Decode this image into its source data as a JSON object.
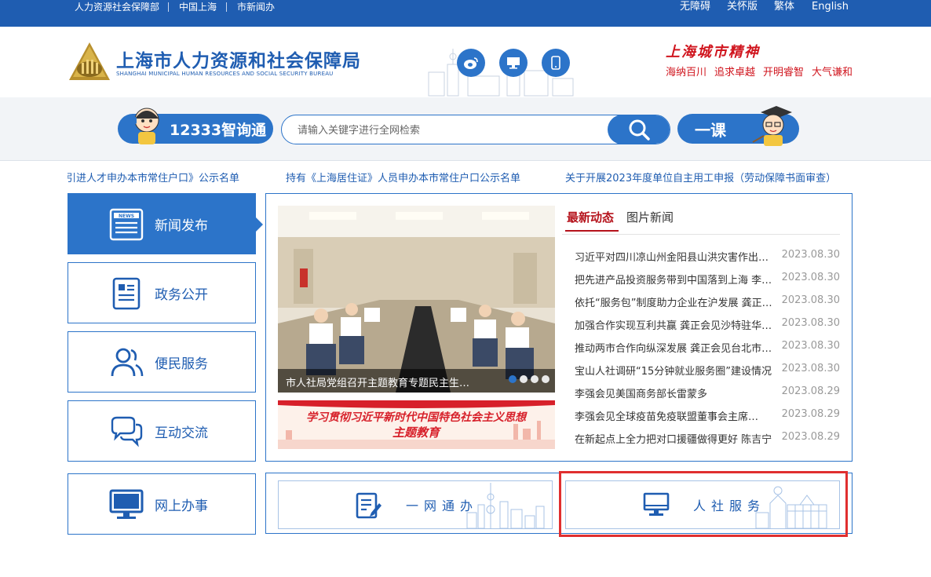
{
  "topbar": {
    "left_links": [
      "人力资源社会保障部",
      "中国上海",
      "市新闻办"
    ],
    "right_links": [
      "无障碍",
      "关怀版",
      "繁体",
      "English"
    ]
  },
  "header": {
    "title_cn": "上海市人力资源和社会保障局",
    "title_en": "SHANGHAI MUNICIPAL HUMAN RESOURCES AND SOCIAL SECURITY BUREAU",
    "icons": [
      "weibo-icon",
      "desktop-icon",
      "mobile-icon"
    ],
    "spirit_title": "上海城市精神",
    "spirit_words": [
      "海纳百川",
      "追求卓越",
      "开明睿智",
      "大气谦和"
    ]
  },
  "search": {
    "hotline_label": "12333智询通",
    "placeholder": "请输入关键字进行全网检索",
    "course_label": "一课"
  },
  "ticker": [
    "引进人才申办本市常住户口》公示名单",
    "持有《上海居住证》人员申办本市常住户口公示名单",
    "关于开展2023年度单位自主用工申报（劳动保障书面审查）"
  ],
  "nav": [
    {
      "label": "新闻发布",
      "icon": "news-icon",
      "active": true
    },
    {
      "label": "政务公开",
      "icon": "document-icon",
      "active": false
    },
    {
      "label": "便民服务",
      "icon": "people-icon",
      "active": false
    },
    {
      "label": "互动交流",
      "icon": "chat-icon",
      "active": false
    },
    {
      "label": "网上办事",
      "icon": "monitor-icon",
      "active": false
    }
  ],
  "news": {
    "carousel_caption": "市人社局党组召开主题教育专题民主生…",
    "carousel_slides": 4,
    "carousel_active": 0,
    "banner_line1": "学习贯彻习近平新时代中国特色社会主义思想",
    "banner_line2": "主题教育",
    "tabs": [
      "最新动态",
      "图片新闻"
    ],
    "items": [
      {
        "title": "习近平对四川凉山州金阳县山洪灾害作出重要指示",
        "date": "2023.08.30"
      },
      {
        "title": "把先进产品投资服务带到中国落到上海 李强会见",
        "date": "2023.08.30"
      },
      {
        "title": "依托“服务包”制度助力企业在沪发展 龚正调研",
        "date": "2023.08.30"
      },
      {
        "title": "加强合作实现互利共赢 龚正会见沙特驻华大使",
        "date": "2023.08.30"
      },
      {
        "title": "推动两市合作向纵深发展 龚正会见台北市副市长",
        "date": "2023.08.30"
      },
      {
        "title": "宝山人社调研“15分钟就业服务圈”建设情况",
        "date": "2023.08.30"
      },
      {
        "title": "李强会见美国商务部长雷蒙多",
        "date": "2023.08.29"
      },
      {
        "title": "李强会见全球疫苗免疫联盟董事会主席…",
        "date": "2023.08.29"
      },
      {
        "title": "在新起点上全力把对口援疆做得更好 陈吉宁",
        "date": "2023.08.29"
      }
    ]
  },
  "services": {
    "left_label": "一网通办",
    "right_label": "人社服务"
  },
  "colors": {
    "brand": "#1f5db1",
    "accent": "#2c74c9",
    "red": "#d0151e",
    "highlight": "#e02f2f"
  }
}
